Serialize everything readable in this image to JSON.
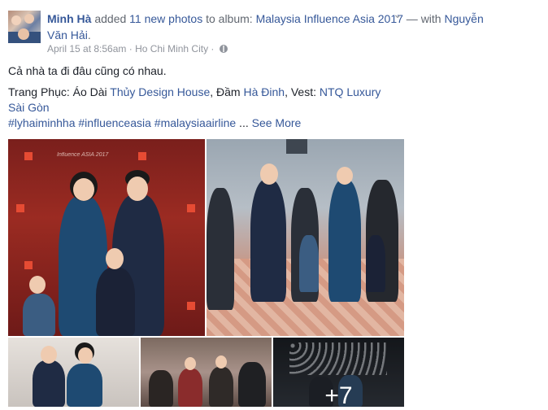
{
  "post": {
    "author": "Minh Hà",
    "action_text": " added ",
    "photo_count_link": "11 new photos",
    "to_album_text": " to album: ",
    "album_name": "Malaysia Influence Asia 2017",
    "with_text": " — with ",
    "tagged_person": "Nguyễn Văn Hải",
    "end_punct": ".",
    "date": "April 15 at 8:56am",
    "separator": " · ",
    "location": "Ho Chi Minh City",
    "line1": "Cả nhà ta đi đâu cũng có nhau.",
    "line2_prefix": "Trang Phục: Áo Dài ",
    "line2_link1": "Thủy Design House",
    "line2_mid": ", Đầm ",
    "line2_link2": "Hà Đinh",
    "line2_mid2": ", Vest: ",
    "line2_link3": "NTQ Luxury Sài Gòn",
    "hashtags": "#lyhaiminhha #influenceasia #malaysiaairline",
    "ellipsis": " ... ",
    "see_more": "See More",
    "more_photos": "+7",
    "watermark": "Influence ASIA 2017"
  },
  "icons": {
    "options": "chevron-down-icon",
    "privacy": "globe-icon"
  },
  "colors": {
    "link": "#365899",
    "text": "#1d2129",
    "meta": "#90949c"
  }
}
